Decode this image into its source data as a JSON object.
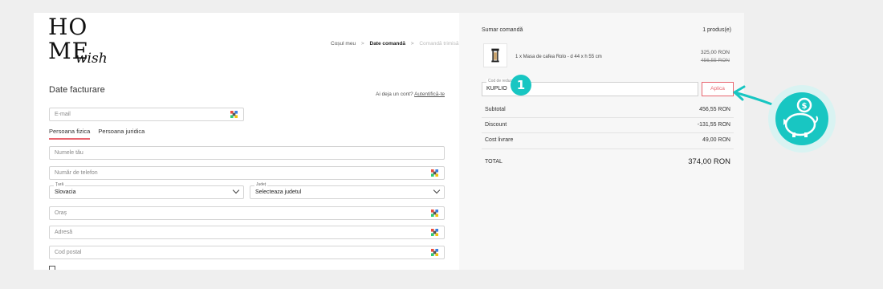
{
  "logo": {
    "line1": "HO",
    "line2": "ME",
    "script": "wish"
  },
  "breadcrumb": {
    "cart": "Coșul meu",
    "sep1": ">",
    "billing": "Date comandă",
    "sep2": ">",
    "sent": "Comandă trimisă"
  },
  "billing": {
    "title": "Date facturare",
    "login_prompt": "Ai deja un cont?",
    "login_link": "Autentifică-te",
    "email_placeholder": "E-mail",
    "tabs": [
      "Persoana fizica",
      "Persoana juridica"
    ],
    "name_placeholder": "Numele tău",
    "phone_placeholder": "Număr de telefon",
    "country_label": "Țară",
    "country_value": "Slovacia",
    "county_label": "Județ",
    "county_value": "Selecteaza judetul",
    "city_placeholder": "Oraș",
    "address_placeholder": "Adresă",
    "postal_placeholder": "Cod postal"
  },
  "summary": {
    "title": "Sumar comandă",
    "count": "1 produs(e)",
    "item_name": "1 x Masa de cafea Rolo - d 44 x h 55 cm",
    "price_new": "325,00 RON",
    "price_old": "456,55 RON",
    "coupon_label": "Cod de reducere",
    "coupon_value": "KUPLIO",
    "apply_label": "Aplica",
    "rows": [
      {
        "label": "Subtotal",
        "value": "456,55 RON"
      },
      {
        "label": "Discount",
        "value": "-131,55 RON"
      },
      {
        "label": "Cost livrare",
        "value": "49,00 RON"
      }
    ],
    "total_label": "TOTAL",
    "total_value": "374,00 RON"
  },
  "annotation": {
    "step": "1",
    "color": "#18c6c2"
  }
}
